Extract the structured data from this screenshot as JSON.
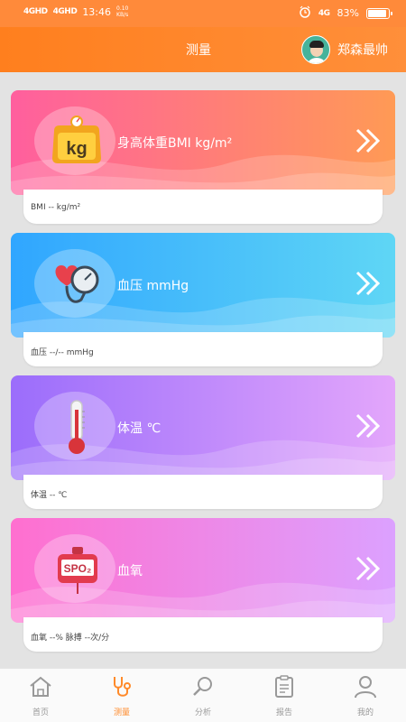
{
  "status": {
    "net1": "4GHD",
    "net2": "4GHD",
    "time": "13:46",
    "speed_top": "0.10",
    "speed_bottom": "KB/s",
    "net_right": "4G",
    "battery": "83%"
  },
  "header": {
    "title": "测量",
    "username": "郑森最帅"
  },
  "cards": [
    {
      "label": "身高体重BMI kg/m²",
      "detail": "BMI -- kg/m²",
      "icon": "kg-scale-icon",
      "colors": [
        "#ff5f9e",
        "#ff9a55"
      ]
    },
    {
      "label": "血压 mmHg",
      "detail": "血压 --/-- mmHg",
      "icon": "blood-pressure-icon",
      "colors": [
        "#30a6ff",
        "#5fd6f5"
      ]
    },
    {
      "label": "体温 ℃",
      "detail": "体温 -- ℃",
      "icon": "thermometer-icon",
      "colors": [
        "#9b6dfb",
        "#e3a6fb"
      ]
    },
    {
      "label": "血氧",
      "detail": "血氧 --% 脉搏 --次/分",
      "icon": "spo2-icon",
      "colors": [
        "#ff6fcf",
        "#dca1ff"
      ]
    }
  ],
  "tabs": [
    {
      "label": "首页",
      "icon": "home-icon"
    },
    {
      "label": "测量",
      "icon": "stethoscope-icon",
      "active": true
    },
    {
      "label": "分析",
      "icon": "magnifier-icon"
    },
    {
      "label": "报告",
      "icon": "clipboard-icon"
    },
    {
      "label": "我的",
      "icon": "person-icon"
    }
  ],
  "colors": {
    "accent": "#ff8a2a",
    "header": "#ff7f1e"
  }
}
